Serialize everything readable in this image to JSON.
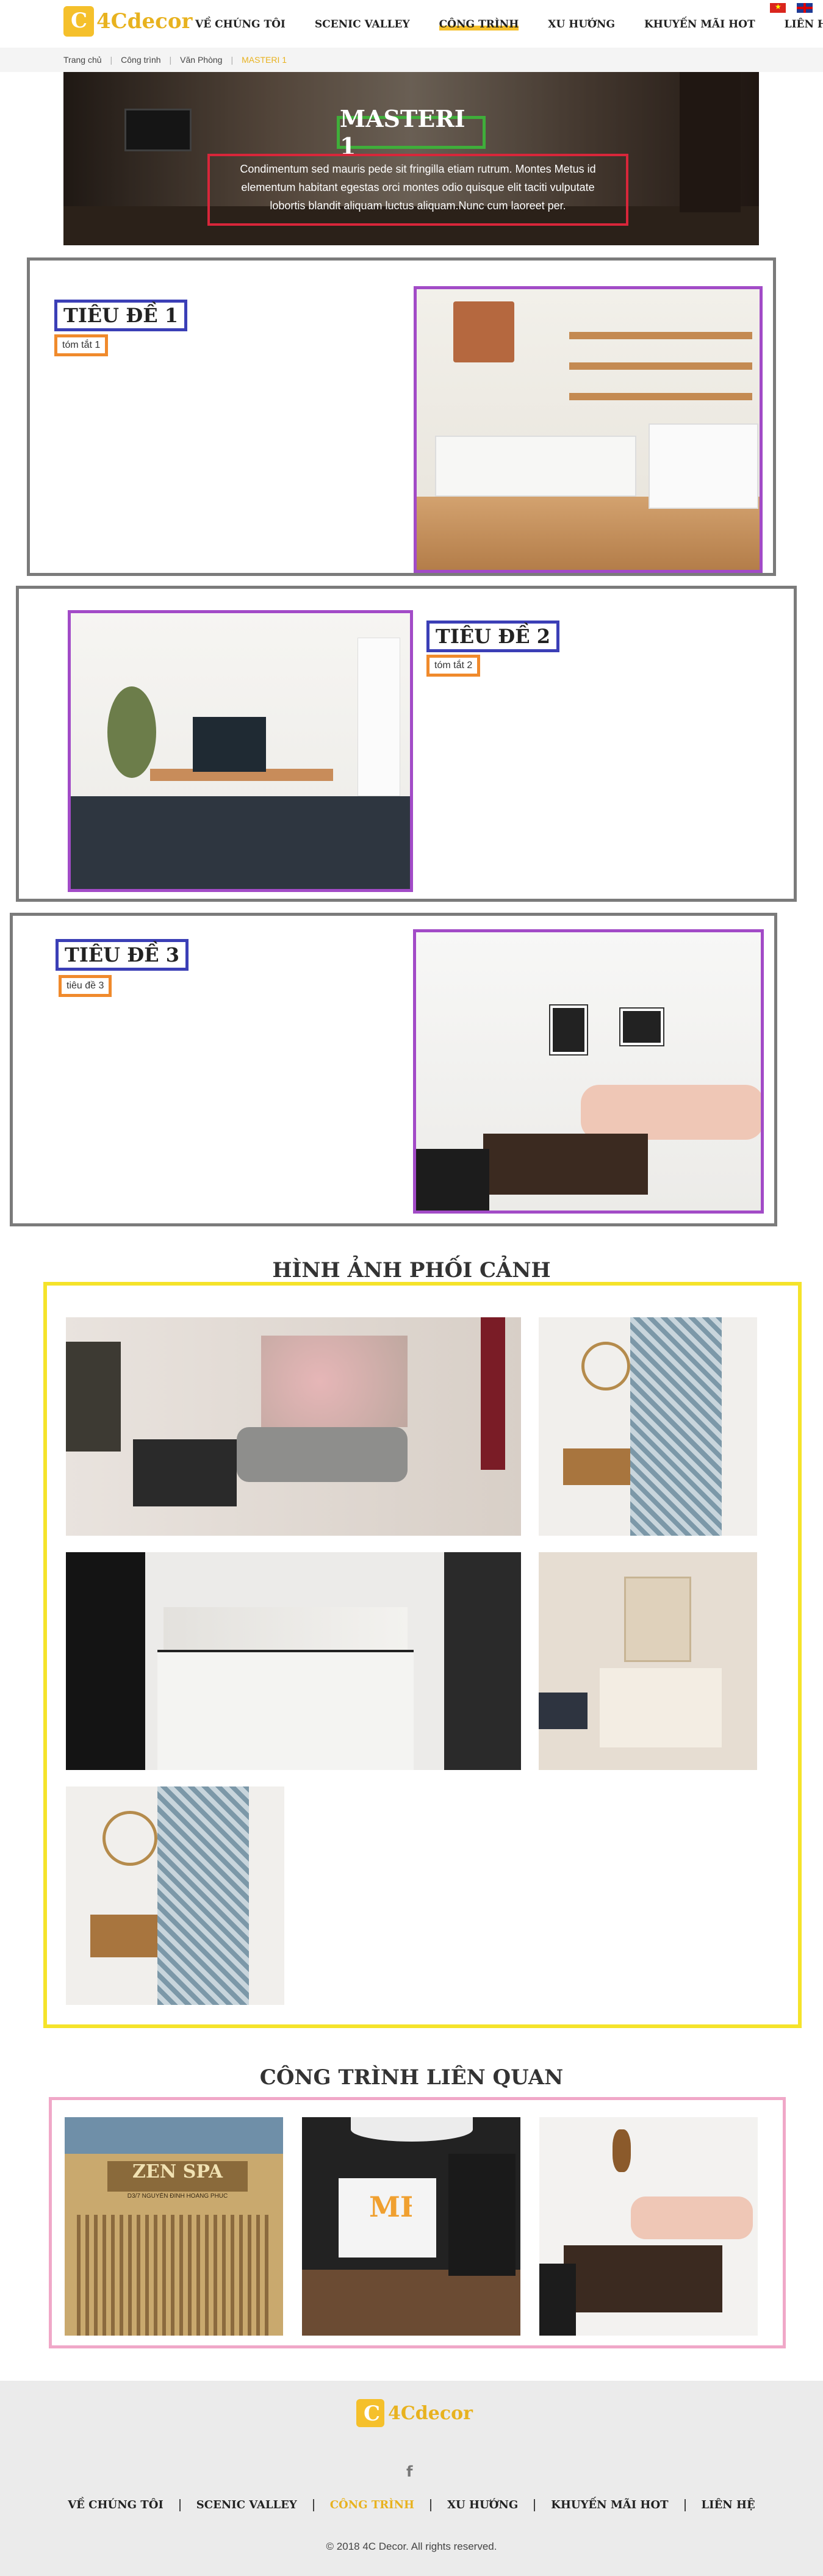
{
  "brand": {
    "name": "4Cdecor"
  },
  "nav": {
    "items": [
      "VỀ CHÚNG TÔI",
      "SCENIC VALLEY",
      "CÔNG TRÌNH",
      "XU HƯỚNG",
      "KHUYẾN MÃI HOT",
      "LIÊN HỆ"
    ],
    "active": "CÔNG TRÌNH"
  },
  "breadcrumb": {
    "items": [
      "Trang chủ",
      "Công trình",
      "Văn Phòng",
      "MASTERI 1"
    ]
  },
  "hero": {
    "title": "MASTERI 1",
    "description": "Condimentum sed mauris pede sit fringilla etiam rutrum. Montes Metus id elementum habitant egestas orci montes odio quisque elit taciti vulputate lobortis blandit aliquam luctus aliquam.Nunc cum laoreet per."
  },
  "blocks": [
    {
      "title": "TIÊU ĐỀ 1",
      "summary": "tóm tắt 1"
    },
    {
      "title": "TIÊU ĐỀ 2",
      "summary": "tóm tắt 2"
    },
    {
      "title": "TIÊU ĐỀ 3",
      "summary": "tiêu đề 3"
    }
  ],
  "gallery": {
    "title": "HÌNH ẢNH PHỐI CẢNH"
  },
  "related": {
    "title": "CÔNG TRÌNH LIÊN QUAN",
    "items": [
      {
        "sign_line1": "ZEN SPA",
        "sign_line2": "D3/7 NGUYỄN ĐÌNH HOÀNG PHÚC"
      },
      {
        "sign_line1": "MF"
      },
      {
        "sign_line1": ""
      }
    ]
  },
  "footer": {
    "nav": [
      "VỀ CHÚNG TÔI",
      "SCENIC VALLEY",
      "CÔNG TRÌNH",
      "XU HƯỚNG",
      "KHUYẾN MÃI HOT",
      "LIÊN HỆ"
    ],
    "active": "CÔNG TRÌNH",
    "social": "f",
    "copyright": "© 2018 4C Decor. All rights reserved."
  },
  "colors": {
    "accent": "#e8b21f",
    "panel_border": "#7b7b7b",
    "title_border": "#3b3fb6",
    "summary_border": "#f08a2c",
    "photo_border": "#a24bc7",
    "gallery_border": "#f5e32a",
    "related_border": "#f0a8c8",
    "hero_title_border": "#3fae3a",
    "hero_desc_border": "#d8263a"
  }
}
